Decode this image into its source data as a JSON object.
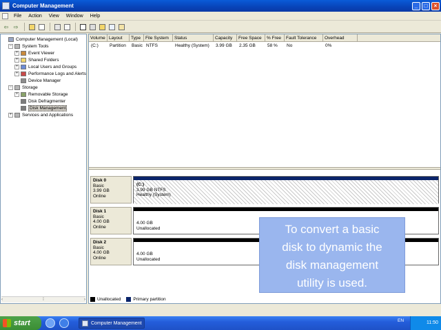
{
  "window": {
    "title": "Computer Management",
    "minimize": "_",
    "maximize": "□",
    "close": "×"
  },
  "menu": [
    "File",
    "Action",
    "View",
    "Window",
    "Help"
  ],
  "toolbar": {
    "back": "⇦",
    "forward": "⇨"
  },
  "tree": [
    {
      "label": "Computer Management (Local)",
      "expander": "",
      "indent": 0,
      "icon_color": "#9aa7c4"
    },
    {
      "label": "System Tools",
      "expander": "−",
      "indent": 1,
      "icon_color": "#b6b6b6"
    },
    {
      "label": "Event Viewer",
      "expander": "+",
      "indent": 2,
      "icon_color": "#c98a3c"
    },
    {
      "label": "Shared Folders",
      "expander": "+",
      "indent": 2,
      "icon_color": "#f3d66a"
    },
    {
      "label": "Local Users and Groups",
      "expander": "+",
      "indent": 2,
      "icon_color": "#6b8bd6"
    },
    {
      "label": "Performance Logs and Alerts",
      "expander": "+",
      "indent": 2,
      "icon_color": "#c94848"
    },
    {
      "label": "Device Manager",
      "expander": "",
      "indent": 2,
      "icon_color": "#8d8d8d"
    },
    {
      "label": "Storage",
      "expander": "−",
      "indent": 1,
      "icon_color": "#b6b6b6"
    },
    {
      "label": "Removable Storage",
      "expander": "+",
      "indent": 2,
      "icon_color": "#8aa36a"
    },
    {
      "label": "Disk Defragmenter",
      "expander": "",
      "indent": 2,
      "icon_color": "#7c7c7c"
    },
    {
      "label": "Disk Management",
      "expander": "",
      "indent": 2,
      "icon_color": "#7c7c7c",
      "selected": true
    },
    {
      "label": "Services and Applications",
      "expander": "+",
      "indent": 1,
      "icon_color": "#b6b6b6"
    }
  ],
  "tree_scroll": {
    "left": "‹",
    "mid": "⁞",
    "right": "›"
  },
  "volume_columns": [
    "Volume",
    "Layout",
    "Type",
    "File System",
    "Status",
    "Capacity",
    "Free Space",
    "% Free",
    "Fault Tolerance",
    "Overhead"
  ],
  "volume_rows": [
    [
      "(C:)",
      "Partition",
      "Basic",
      "NTFS",
      "Healthy (System)",
      "3.99 GB",
      "2.35 GB",
      "58 %",
      "No",
      "0%"
    ]
  ],
  "disks": [
    {
      "name": "Disk 0",
      "type": "Basic",
      "size": "3.99 GB",
      "status": "Online",
      "part_title": "(C:)",
      "part_size": "3.99 GB NTFS",
      "part_status": "Healthy (System)"
    },
    {
      "name": "Disk 1",
      "type": "Basic",
      "size": "4.00 GB",
      "status": "Online",
      "part_size": "4.00 GB",
      "part_status": "Unallocated"
    },
    {
      "name": "Disk 2",
      "type": "Basic",
      "size": "4.00 GB",
      "status": "Online",
      "part_size": "4.00 GB",
      "part_status": "Unallocated"
    }
  ],
  "legend": [
    {
      "label": "Unallocated",
      "color": "#000000"
    },
    {
      "label": "Primary partition",
      "color": "#0a246a"
    }
  ],
  "callout": {
    "lines": [
      "To convert a basic",
      "disk to dynamic the",
      "disk management",
      "utility is used."
    ]
  },
  "taskbar": {
    "start": "start",
    "task": "Computer Management",
    "lang": "EN",
    "clock": "11:50"
  }
}
